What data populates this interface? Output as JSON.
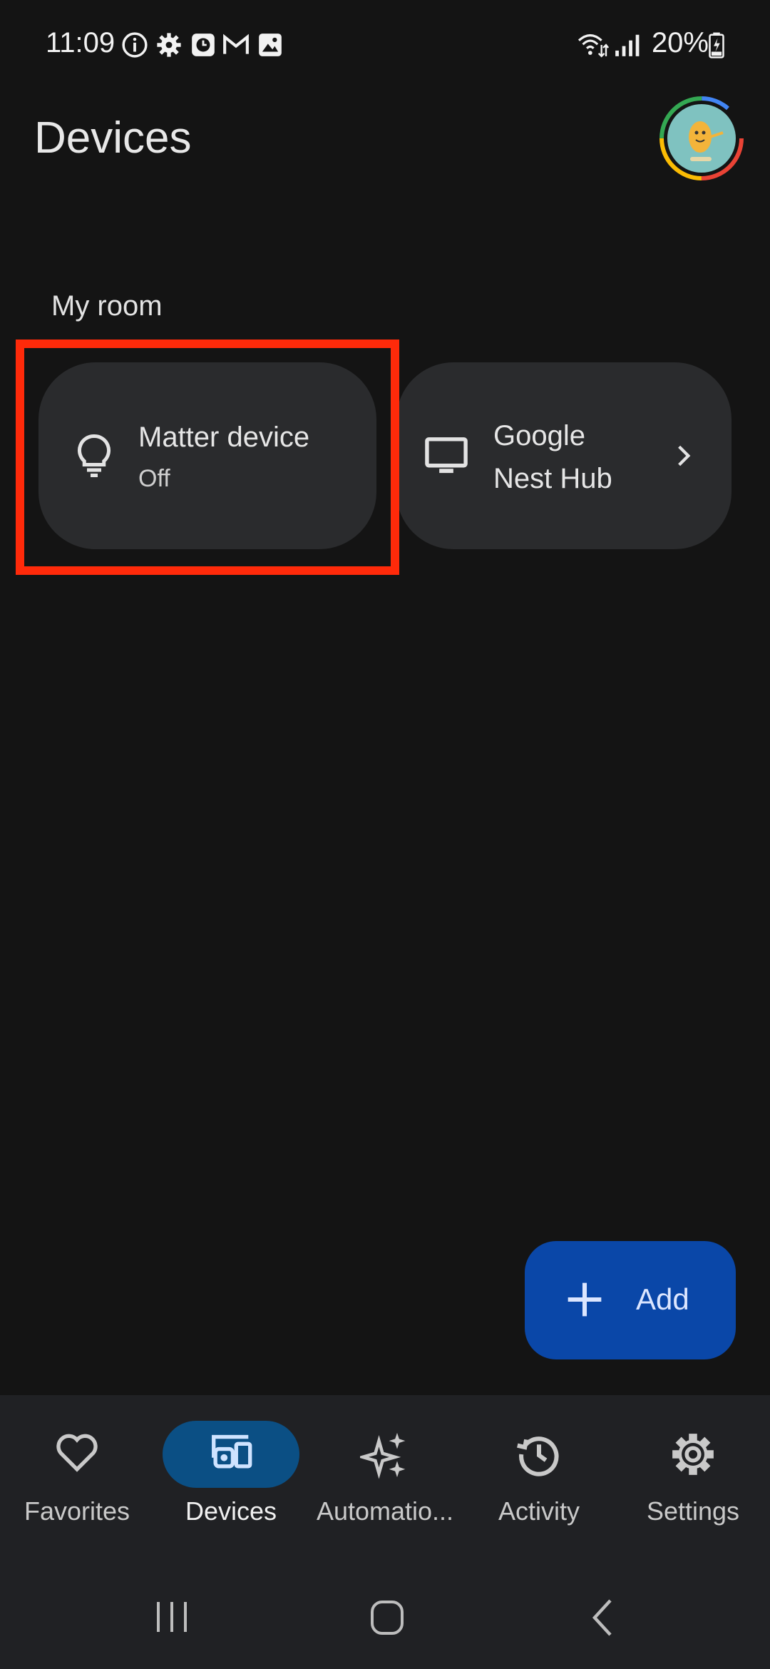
{
  "status_bar": {
    "time": "11:09",
    "battery": "20%",
    "icons": [
      "info-icon",
      "settings-icon",
      "clock-app-icon",
      "gmail-icon",
      "gallery-icon",
      "wifi-icon",
      "signal-icon",
      "battery-icon"
    ]
  },
  "header": {
    "title": "Devices"
  },
  "room": {
    "label": "My room",
    "devices": [
      {
        "name": "Matter device",
        "status": "Off",
        "icon": "lightbulb-icon"
      },
      {
        "name_line1": "Google",
        "name_line2": "Nest Hub",
        "icon": "display-icon"
      }
    ]
  },
  "fab": {
    "label": "Add",
    "icon": "plus-icon"
  },
  "bottom_nav": {
    "items": [
      {
        "label": "Favorites",
        "icon": "heart-icon"
      },
      {
        "label": "Devices",
        "icon": "devices-icon",
        "selected": true
      },
      {
        "label": "Automatio...",
        "icon": "sparkle-icon"
      },
      {
        "label": "Activity",
        "icon": "history-icon"
      },
      {
        "label": "Settings",
        "icon": "gear-icon"
      }
    ]
  },
  "colors": {
    "background": "#141414",
    "tile": "#2a2b2d",
    "highlight": "#ff2a0a",
    "fab": "#0a47a8",
    "nav_selected": "#0b4f84"
  }
}
